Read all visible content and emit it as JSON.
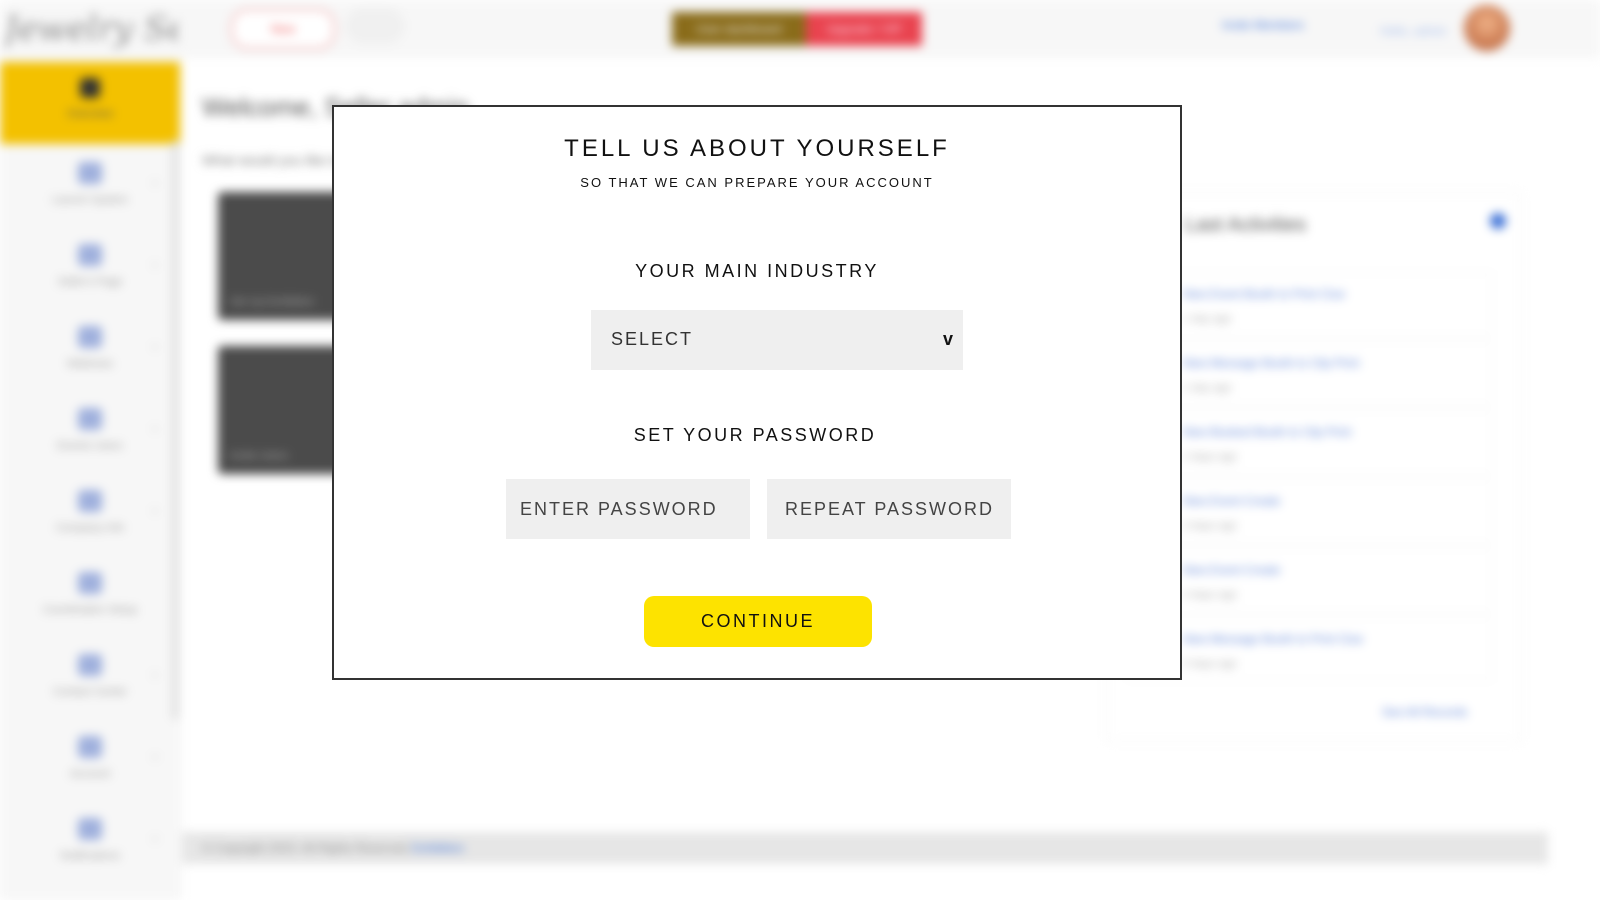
{
  "background": {
    "logo_text": "Jewelry Sellers",
    "active_nav_label": "Overview",
    "nav_items": [
      {
        "label": "Launch System"
      },
      {
        "label": "Seller's Page"
      },
      {
        "label": "Webinars"
      },
      {
        "label": "Events Users"
      },
      {
        "label": "Company Info"
      },
      {
        "label": "Coordination Setup"
      },
      {
        "label": "Contact Center"
      },
      {
        "label": "Account"
      },
      {
        "label": "Notifications"
      }
    ],
    "topbar": {
      "new_button": "New",
      "user_dashboard": "User dashboard",
      "upgrade": "Upgrade / VIP",
      "link_1": "Invite Members",
      "link_2": "Hello, admin"
    },
    "welcome_title": "Welcome, Seller admin",
    "welcome_subtitle": "What would you like to do today?",
    "cards": [
      {
        "caption": "Set Up Exhibition"
      },
      {
        "caption": "Invite Users"
      }
    ],
    "panel_title": "Last Activities",
    "activities": [
      {
        "line1": "New Event Booth to Print Clue",
        "line2": "1 day ago"
      },
      {
        "line1": "New Message Booth to Clip Print",
        "line2": "1 day ago"
      },
      {
        "line1": "New Booked Booth to Clip Print",
        "line2": "2 days ago"
      },
      {
        "line1": "New Event Create",
        "line2": "3 days ago"
      },
      {
        "line1": "New Event Create",
        "line2": "4 days ago"
      },
      {
        "line1": "New Message Booth to Print Clue",
        "line2": "5 days ago"
      }
    ],
    "see_all": "See All Records",
    "footer_text": "© Copyright 2023. All Rights Reserved.",
    "footer_link": "Exhibition"
  },
  "modal": {
    "title": "TELL US ABOUT YOURSELF",
    "subtitle": "SO THAT WE CAN PREPARE YOUR ACCOUNT",
    "industry_heading": "YOUR MAIN INDUSTRY",
    "industry_select_value": "SELECT",
    "industry_arrow_glyph": "v",
    "password_heading": "SET YOUR PASSWORD",
    "password_placeholder": "ENTER PASSWORD",
    "repeat_password_placeholder": "REPEAT PASSWORD",
    "continue_label": "CONTINUE"
  },
  "colors": {
    "accent_yellow": "#fde300",
    "sidebar_active": "#f3c100",
    "field_bg": "#efefef",
    "modal_border": "#333333"
  }
}
